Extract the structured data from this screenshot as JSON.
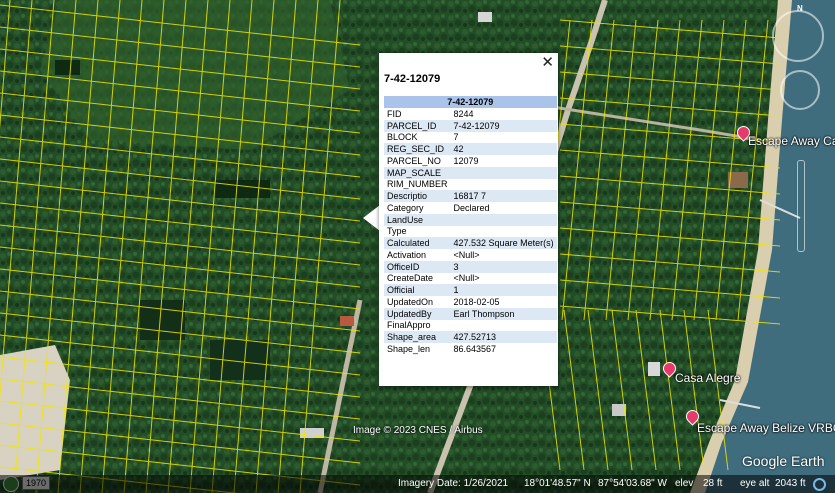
{
  "popup": {
    "title": "7-42-12079",
    "close_glyph": "✕",
    "table_header": "7-42-12079",
    "rows": [
      {
        "key": "FID",
        "value": "8244"
      },
      {
        "key": "PARCEL_ID",
        "value": "7-42-12079"
      },
      {
        "key": "BLOCK",
        "value": "7"
      },
      {
        "key": "REG_SEC_ID",
        "value": "42"
      },
      {
        "key": "PARCEL_NO",
        "value": "12079"
      },
      {
        "key": "MAP_SCALE",
        "value": ""
      },
      {
        "key": "RIM_NUMBER",
        "value": ""
      },
      {
        "key": "Descriptio",
        "value": "16817 7"
      },
      {
        "key": "Category",
        "value": "Declared"
      },
      {
        "key": "LandUse",
        "value": ""
      },
      {
        "key": "Type",
        "value": ""
      },
      {
        "key": "Calculated",
        "value": "427.532 Square Meter(s)"
      },
      {
        "key": "Activation",
        "value": "<Null>"
      },
      {
        "key": "OfficeID",
        "value": "3"
      },
      {
        "key": "CreateDate",
        "value": "<Null>"
      },
      {
        "key": "Official",
        "value": "1"
      },
      {
        "key": "UpdatedOn",
        "value": "2018-02-05"
      },
      {
        "key": "UpdatedBy",
        "value": "Earl Thompson"
      },
      {
        "key": "FinalAppro",
        "value": ""
      },
      {
        "key": "Shape_area",
        "value": "427.52713"
      },
      {
        "key": "Shape_len",
        "value": "86.643567"
      }
    ]
  },
  "places": {
    "escape_away_casa": "Escape Away Casa C",
    "casa_alegre": "Casa Alegre",
    "escape_away_belize": "Escape Away Belize VRBO"
  },
  "map_overlay": {
    "copyright": "Image © 2023 CNES / Airbus",
    "logo": "Google Earth",
    "compass_north": "N"
  },
  "statusbar": {
    "year": "1970",
    "imagery_date": "Imagery Date: 1/26/2021",
    "lat": "18°01'48.57\" N",
    "lon": "87°54'03.68\" W",
    "elev_label": "elev",
    "elev_value": "28 ft",
    "eye_alt_label": "eye alt",
    "eye_alt_value": "2043 ft"
  },
  "colors": {
    "parcel_lines": "#f2e600",
    "forest": "#1f4a24",
    "sea": "#3f6d7e",
    "header_blue": "#a9c4e8",
    "pin": "#e53a6a"
  }
}
